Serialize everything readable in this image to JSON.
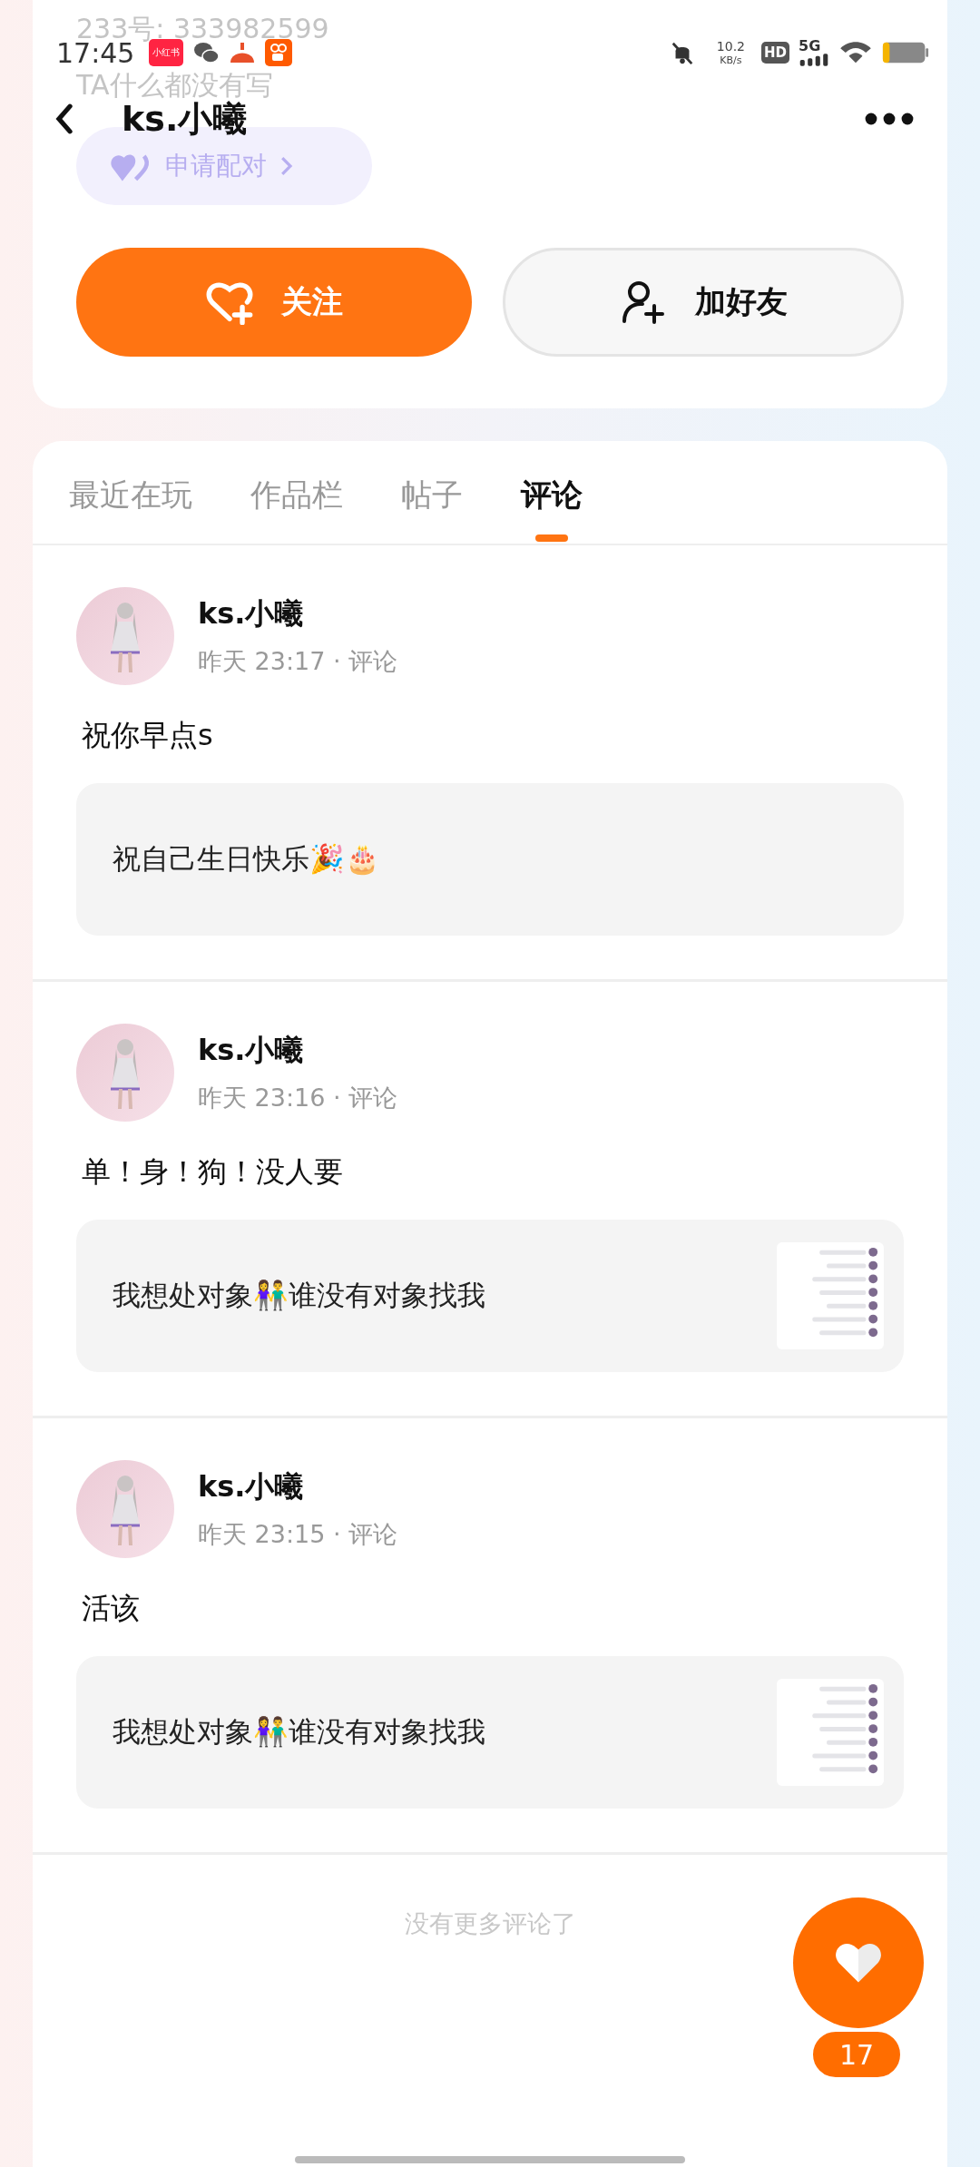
{
  "status_bar": {
    "time": "17:45",
    "notifications": [
      {
        "kind": "redbook",
        "label": "小红书"
      },
      {
        "kind": "chat"
      },
      {
        "kind": "game"
      },
      {
        "kind": "video"
      }
    ],
    "speed": "10.2",
    "speed_unit": "KB/s",
    "hd": "HD",
    "network": "5G"
  },
  "profile": {
    "account_id": "233号: 333982599",
    "bio": "TA什么都没有写",
    "pair_button": "申请配对"
  },
  "header": {
    "title": "ks.小曦"
  },
  "actions": [
    {
      "kind": "follow",
      "label": "关注"
    },
    {
      "kind": "friend",
      "label": "加好友"
    }
  ],
  "tabs": [
    {
      "label": "最近在玩",
      "selected": false
    },
    {
      "label": "作品栏",
      "selected": false
    },
    {
      "label": "帖子",
      "selected": false
    },
    {
      "label": "评论",
      "selected": true
    }
  ],
  "comments": [
    {
      "author": "ks.小曦",
      "meta": "昨天 23:17 · 评论",
      "text": "祝你早点s",
      "quote": {
        "text": "祝自己生日快乐🎉🎂",
        "thumbnail": false
      }
    },
    {
      "author": "ks.小曦",
      "meta": "昨天 23:16 · 评论",
      "text": "单！身！狗！没人要",
      "quote": {
        "text": "我想处对象👫谁没有对象找我",
        "thumbnail": true
      }
    },
    {
      "author": "ks.小曦",
      "meta": "昨天 23:15 · 评论",
      "text": "活该",
      "quote": {
        "text": "我想处对象👫谁没有对象找我",
        "thumbnail": true
      }
    }
  ],
  "footer": "没有更多评论了",
  "like_button": {
    "count": "17"
  }
}
